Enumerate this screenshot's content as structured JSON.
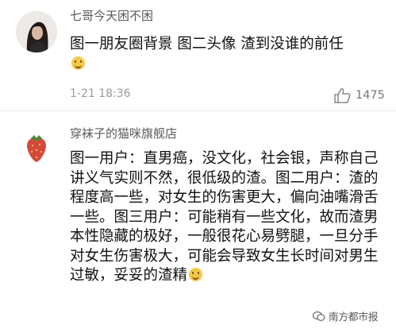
{
  "comments": [
    {
      "username": "七哥今天困不困",
      "text": "图一朋友圈背景 图二头像 渣到没谁的前任",
      "time": "1-21 18:36",
      "likes": "1475",
      "avatar_icon": "woman-portrait-avatar"
    },
    {
      "username": "穿袜子的猫咪旗舰店",
      "text": "图一用户：直男癌，没文化，社会银，声称自己讲义气实则不然，很低级的渣。图二用户：渣的程度高一些，对女生的伤害更大，偏向油嘴滑舌一些。图三用户：可能稍有一些文化，故而渣男本性隐藏的极好，一般很花心易劈腿，一旦分手对女生伤害极大，可能会导致女生长时间对男生过敏，妥妥的渣精",
      "avatar_icon": "strawberry-avatar"
    }
  ],
  "watermark": {
    "text": "南方都市报",
    "icon": "wechat-channel-icon"
  }
}
